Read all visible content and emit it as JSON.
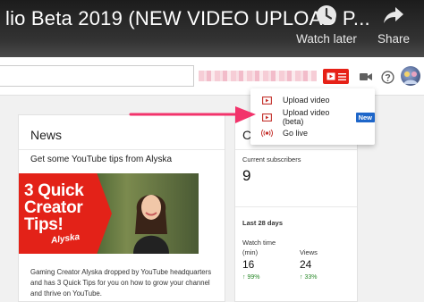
{
  "video": {
    "title": "lio Beta 2019 (NEW VIDEO UPLOAD P...",
    "watch_later_label": "Watch later",
    "share_label": "Share"
  },
  "header": {
    "search_value": "",
    "icons": [
      "create-video-icon",
      "hamburger-icon",
      "video-camera-icon",
      "help-icon",
      "avatar"
    ]
  },
  "dropdown": {
    "items": [
      {
        "label": "Upload video",
        "icon": "upload-play-icon"
      },
      {
        "label": "Upload video (beta)",
        "icon": "upload-play-icon",
        "badge": "New"
      },
      {
        "label": "Go live",
        "icon": "live-broadcast-icon"
      }
    ]
  },
  "news": {
    "title": "News",
    "subtitle": "Get some YouTube tips from Alyska",
    "thumbnail": {
      "text_line1": "3 Quick",
      "text_line2": "Creator",
      "text_line3": "Tips!",
      "signature": "Alyska"
    },
    "body": "Gaming Creator Alyska dropped by YouTube headquarters and has 3 Quick Tips for you on how to grow your channel and thrive on YouTube."
  },
  "channel": {
    "title_clip": "Ch",
    "subscribers_label": "Current subscribers",
    "subscribers_value": "9",
    "period_label": "Last 28 days",
    "watch_time_label": "Watch time",
    "watch_time_unit": "(min)",
    "watch_time_value": "16",
    "watch_time_change": "99%",
    "views_label": "Views",
    "views_value": "24",
    "views_change": "33%"
  },
  "colors": {
    "accent_red": "#e62117",
    "badge_blue": "#1e66c9",
    "arrow_pink": "#f2336b",
    "positive_green": "#2b8a2b"
  }
}
